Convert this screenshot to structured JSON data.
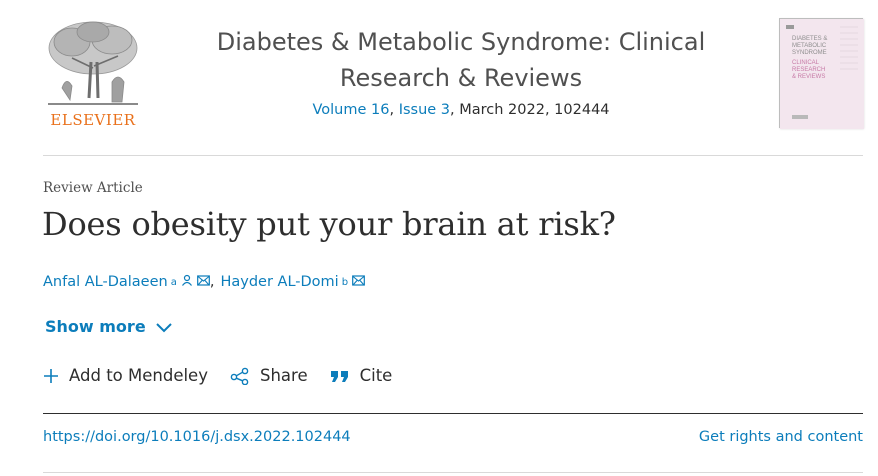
{
  "publisher": {
    "wordmark": "ELSEVIER",
    "color": "#e9711c"
  },
  "journal": {
    "title_line1": "Diabetes & Metabolic Syndrome: Clinical",
    "title_line2": "Research & Reviews",
    "volume": "Volume 16",
    "issue": "Issue 3",
    "date_article": ", March 2022, 102444",
    "cover_alt": "DIABETES & METABOLIC SYNDROME CLINICAL RESEARCH & REVIEWS"
  },
  "article": {
    "type": "Review Article",
    "title": "Does obesity put your brain at risk?",
    "authors": [
      {
        "name": "Anfal AL-Dalaeen",
        "sup": "a",
        "icons": [
          "person-icon",
          "mail-icon"
        ]
      },
      {
        "name": "Hayder AL-Domi",
        "sup": "b",
        "icons": [
          "mail-icon"
        ]
      }
    ],
    "author_separator": ","
  },
  "controls": {
    "show_more": "Show more",
    "add_mendeley": "Add to Mendeley",
    "share": "Share",
    "cite": "Cite"
  },
  "footer": {
    "doi": "https://doi.org/10.1016/j.dsx.2022.102444",
    "rights": "Get rights and content"
  },
  "colors": {
    "link": "#0c7dbb",
    "text": "#2e2e2e",
    "muted": "#505050"
  }
}
